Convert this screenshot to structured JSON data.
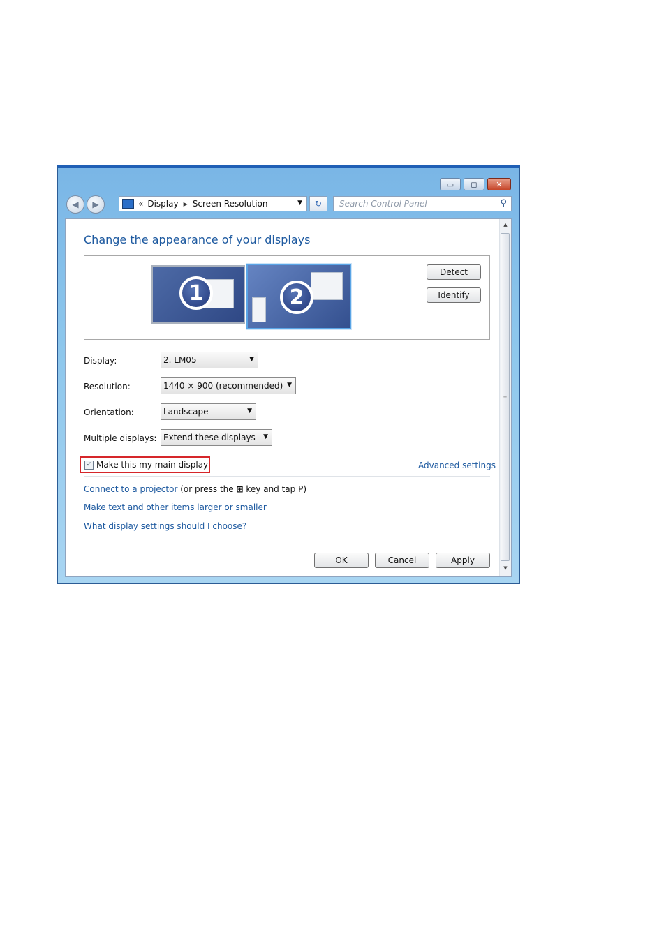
{
  "window": {
    "caption_buttons": {
      "minimize": "▭",
      "maximize": "◻",
      "close": "✕"
    },
    "nav": {
      "back_glyph": "◀",
      "forward_glyph": "▶",
      "breadcrumb_prefix": "«",
      "breadcrumb": [
        "Display",
        "Screen Resolution"
      ],
      "breadcrumb_sep": "▶",
      "dropdown_glyph": "▼",
      "refresh_glyph": "↻",
      "search_placeholder": "Search Control Panel",
      "search_glyph": "⚲"
    }
  },
  "content": {
    "heading": "Change the appearance of your displays",
    "monitors": [
      {
        "number": "1"
      },
      {
        "number": "2"
      }
    ],
    "detect_label": "Detect",
    "identify_label": "Identify",
    "fields": {
      "display": {
        "label": "Display:",
        "value": "2. LM05"
      },
      "resolution": {
        "label": "Resolution:",
        "value": "1440 × 900 (recommended)"
      },
      "orientation": {
        "label": "Orientation:",
        "value": "Landscape"
      },
      "multiple": {
        "label": "Multiple displays:",
        "value": "Extend these displays"
      }
    },
    "caret": "▼",
    "main_display": {
      "label": "Make this my main display",
      "checked": true,
      "check_glyph": "✓"
    },
    "advanced_link": "Advanced settings",
    "projector": {
      "link": "Connect to a projector",
      "text_before_key": "(or press the",
      "key_glyph": "⊞",
      "text_after_key": "key and tap P)"
    },
    "larger_link": "Make text and other items larger or smaller",
    "help_link": "What display settings should I choose?",
    "buttons": {
      "ok": "OK",
      "cancel": "Cancel",
      "apply": "Apply"
    },
    "scroll": {
      "up": "▲",
      "down": "▼",
      "grip": "≡"
    }
  },
  "colors": {
    "link": "#1e5aa0",
    "highlight_box": "#d6262a",
    "title_accent": "#1f5fb5"
  }
}
